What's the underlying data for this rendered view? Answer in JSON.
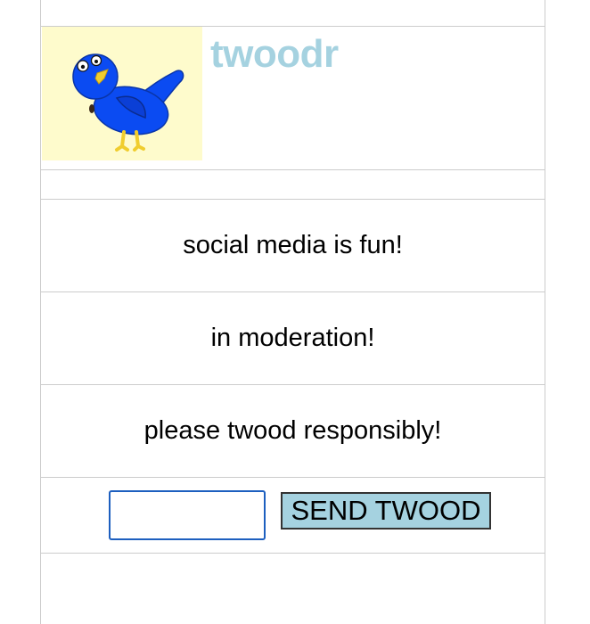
{
  "brand": {
    "name": "twoodr",
    "color": "#a5d2e0",
    "logo_background": "#fefbcc",
    "logo_icon": "blue-bird-icon"
  },
  "feed": {
    "twoods": [
      {
        "text": "social media is fun!"
      },
      {
        "text": "in moderation!"
      },
      {
        "text": "please twood responsibly!"
      }
    ]
  },
  "composer": {
    "input_value": "",
    "input_placeholder": "",
    "send_label": "SEND TWOOD",
    "send_color": "#a5d2e0",
    "focus_color": "#1d5fbf"
  }
}
